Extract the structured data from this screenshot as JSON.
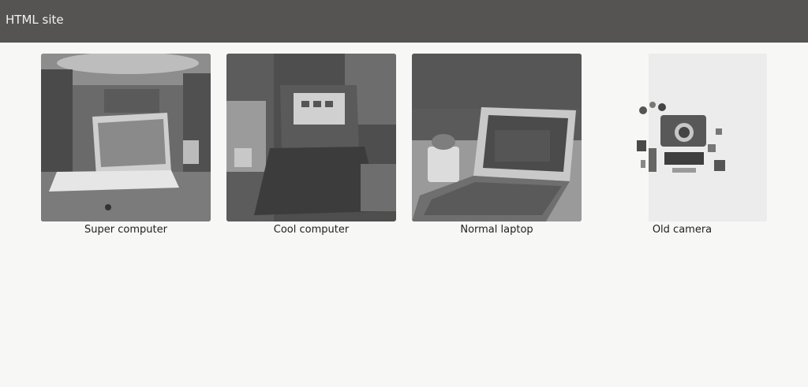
{
  "header": {
    "title": "HTML site",
    "background": "#555453"
  },
  "gallery": {
    "items": [
      {
        "caption": "Super computer",
        "image": "laptop-on-desk-photo"
      },
      {
        "caption": "Cool computer",
        "image": "laptop-dark-desk-photo"
      },
      {
        "caption": "Normal laptop",
        "image": "laptop-with-plant-photo"
      },
      {
        "caption": "Old camera",
        "image": "camera-flatlay-photo"
      }
    ]
  }
}
